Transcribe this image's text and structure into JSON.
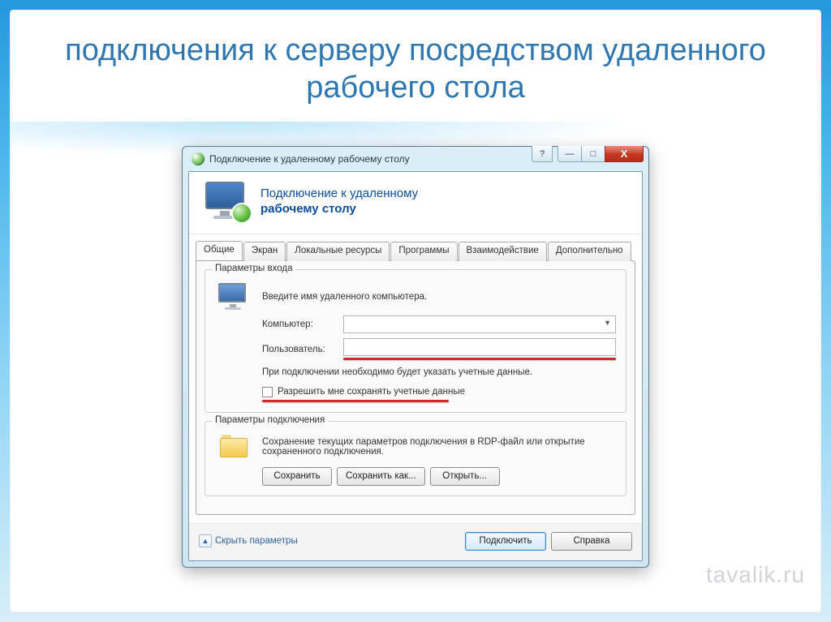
{
  "slide": {
    "title": "подключения к серверу посредством удаленного рабочего стола"
  },
  "window": {
    "title": "Подключение к удаленному рабочему столу",
    "help": "?",
    "close": "X",
    "banner_line1": "Подключение к удаленному",
    "banner_line2": "рабочему столу",
    "tabs": [
      "Общие",
      "Экран",
      "Локальные ресурсы",
      "Программы",
      "Взаимодействие",
      "Дополнительно"
    ],
    "group_login": {
      "title": "Параметры входа",
      "prompt": "Введите имя удаленного компьютера.",
      "computer_label": "Компьютер:",
      "computer_value": "",
      "user_label": "Пользователь:",
      "user_value": "",
      "note": "При подключении необходимо будет указать учетные данные.",
      "save_creds": "Разрешить мне сохранять учетные данные"
    },
    "group_conn": {
      "title": "Параметры подключения",
      "desc": "Сохранение текущих параметров подключения в RDP-файл или открытие сохраненного подключения.",
      "save": "Сохранить",
      "save_as": "Сохранить как...",
      "open": "Открыть..."
    },
    "footer": {
      "collapse": "Скрыть параметры",
      "connect": "Подключить",
      "help": "Справка"
    }
  },
  "watermark": "tavalik.ru"
}
